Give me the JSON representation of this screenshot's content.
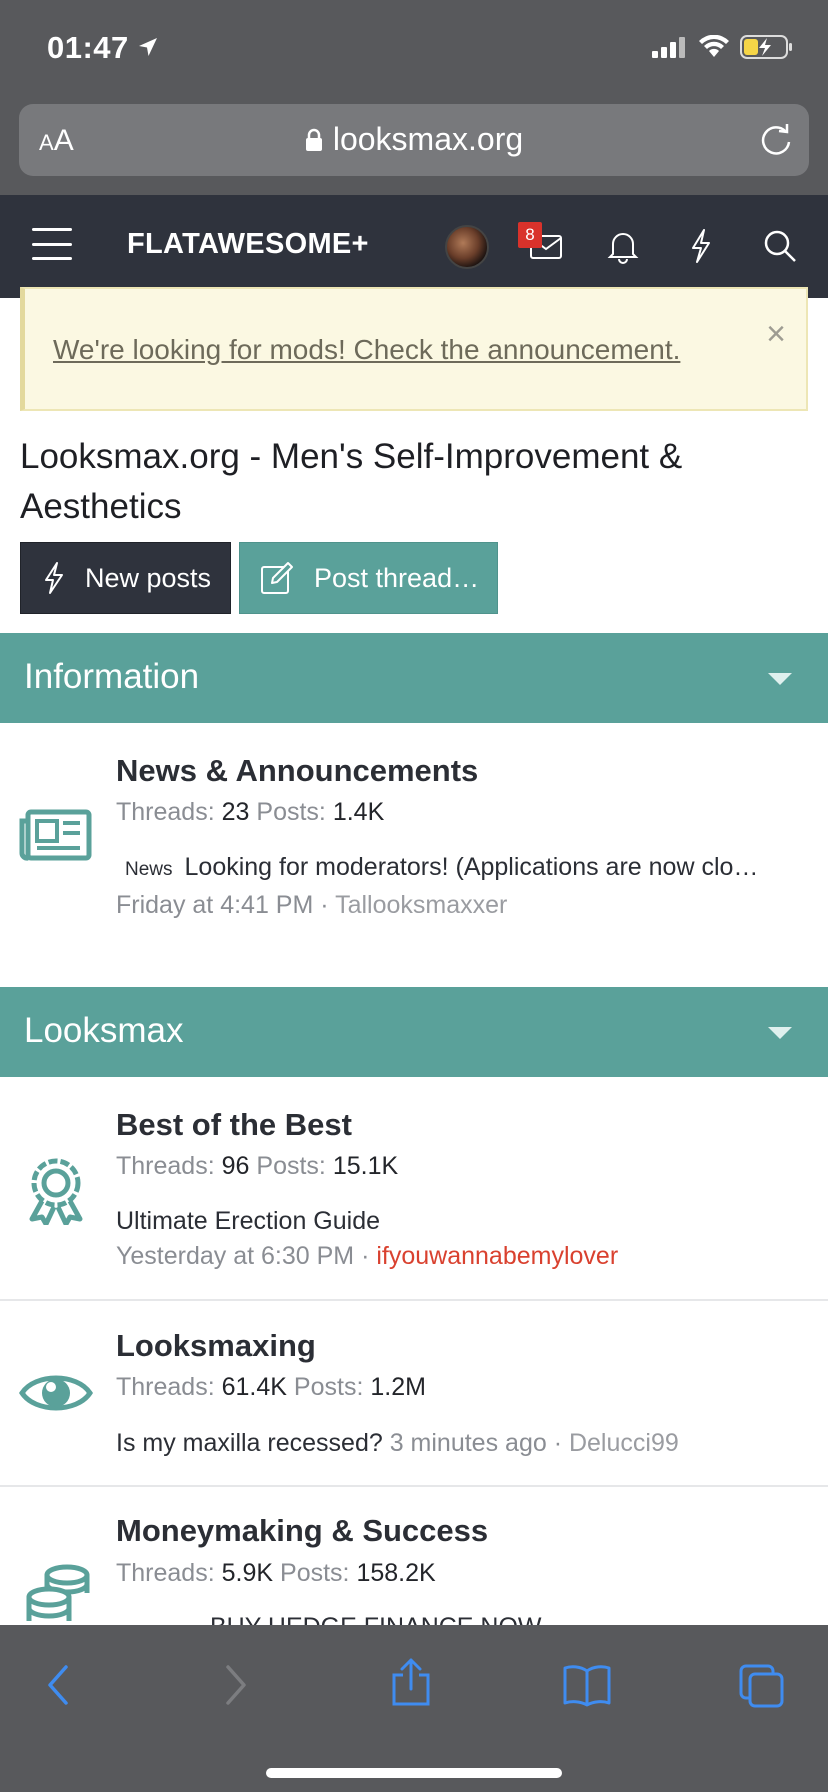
{
  "status_bar": {
    "time": "01:47"
  },
  "browser": {
    "aa_label_small": "A",
    "aa_label_large": "A",
    "url": "looksmax.org"
  },
  "header": {
    "brand": "FLATAWESOME+",
    "inbox_badge": "8"
  },
  "notice": {
    "text": "We're looking for mods! Check the announcement.",
    "close": "×"
  },
  "page": {
    "title": "Looksmax.org - Men's Self-Improvement & Aesthetics",
    "new_posts_label": "New posts",
    "post_thread_label": "Post thread…"
  },
  "sections": [
    {
      "title": "Information",
      "forums": [
        {
          "name": "News & Announcements",
          "threads_label": "Threads:",
          "threads": "23",
          "posts_label": "Posts:",
          "posts": "1.4K",
          "latest_prefix": "News",
          "latest_title": "Looking for moderators! (Applications are now clo…",
          "latest_time": "Friday at 4:41 PM",
          "latest_user": "Tallooksmaxxer"
        }
      ]
    },
    {
      "title": "Looksmax",
      "forums": [
        {
          "name": "Best of the Best",
          "threads_label": "Threads:",
          "threads": "96",
          "posts_label": "Posts:",
          "posts": "15.1K",
          "latest_title": "Ultimate Erection Guide",
          "latest_time": "Yesterday at 6:30 PM",
          "latest_user": "ifyouwannabemylover"
        },
        {
          "name": "Looksmaxing",
          "threads_label": "Threads:",
          "threads": "61.4K",
          "posts_label": "Posts:",
          "posts": "1.2M",
          "latest_title": "Is my maxilla recessed?",
          "latest_time": "3 minutes ago",
          "latest_user": "Delucci99"
        },
        {
          "name": "Moneymaking & Success",
          "threads_label": "Threads:",
          "threads": "5.9K",
          "posts_label": "Posts:",
          "posts": "158.2K",
          "latest_title": "BUY HEDGE FINANCE NOW"
        }
      ]
    }
  ],
  "separators": {
    "dot": " · "
  },
  "colors": {
    "teal": "#5aa19a",
    "navy": "#2f333d",
    "notice_bg": "#fbf8e2",
    "user_red": "#d9412f",
    "ios_blue": "#3f8cf0"
  }
}
